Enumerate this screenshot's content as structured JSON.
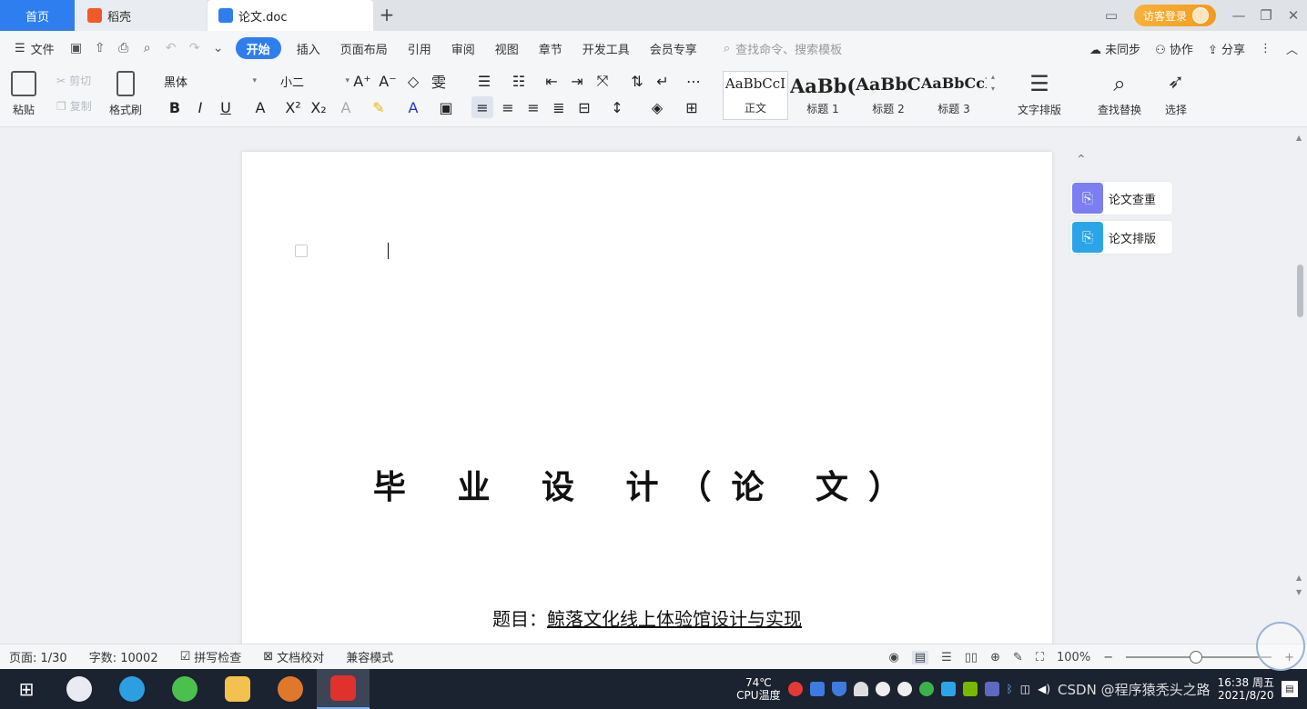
{
  "titlebar": {
    "tabs": [
      {
        "label": "首页"
      },
      {
        "label": "稻壳"
      },
      {
        "label": "论文.doc"
      }
    ],
    "login_label": "访客登录",
    "colors": {
      "accent": "#2f7ef0",
      "login": "#f39a1c"
    }
  },
  "menubar": {
    "file_label": "文件",
    "items": [
      {
        "label": "开始"
      },
      {
        "label": "插入"
      },
      {
        "label": "页面布局"
      },
      {
        "label": "引用"
      },
      {
        "label": "审阅"
      },
      {
        "label": "视图"
      },
      {
        "label": "章节"
      },
      {
        "label": "开发工具"
      },
      {
        "label": "会员专享"
      }
    ],
    "search_placeholder": "查找命令、搜索模板",
    "right": {
      "sync": "未同步",
      "collab": "协作",
      "share": "分享"
    }
  },
  "ribbon": {
    "paste": "粘贴",
    "cut": "剪切",
    "copy": "复制",
    "format_painter": "格式刷",
    "font_name": "黑体",
    "font_size": "小二",
    "styles": [
      {
        "sample": "AaBbCcI",
        "name": "正文"
      },
      {
        "sample": "AaBb(",
        "name": "标题 1"
      },
      {
        "sample": "AaBbC",
        "name": "标题 2"
      },
      {
        "sample": "AaBbCcI",
        "name": "标题 3"
      }
    ],
    "text_layout": "文字排版",
    "find_replace": "查找替换",
    "select": "选择"
  },
  "document": {
    "title": "毕 业 设 计（论 文）",
    "subject_label": "题目：",
    "subject_title": "鲸落文化线上体验馆设计与实现"
  },
  "side_panel": {
    "items": [
      {
        "label": "论文查重"
      },
      {
        "label": "论文排版"
      }
    ]
  },
  "statusbar": {
    "page": "页面: 1/30",
    "word_count": "字数: 10002",
    "spell_check": "拼写检查",
    "doc_proof": "文档校对",
    "compat_mode": "兼容模式",
    "zoom": "100%"
  },
  "taskbar": {
    "cpu_temp": "74℃",
    "cpu_label": "CPU温度",
    "time": "16:38 周五",
    "date": "2021/8/20",
    "watermark": "CSDN @程序猿秃头之路"
  }
}
